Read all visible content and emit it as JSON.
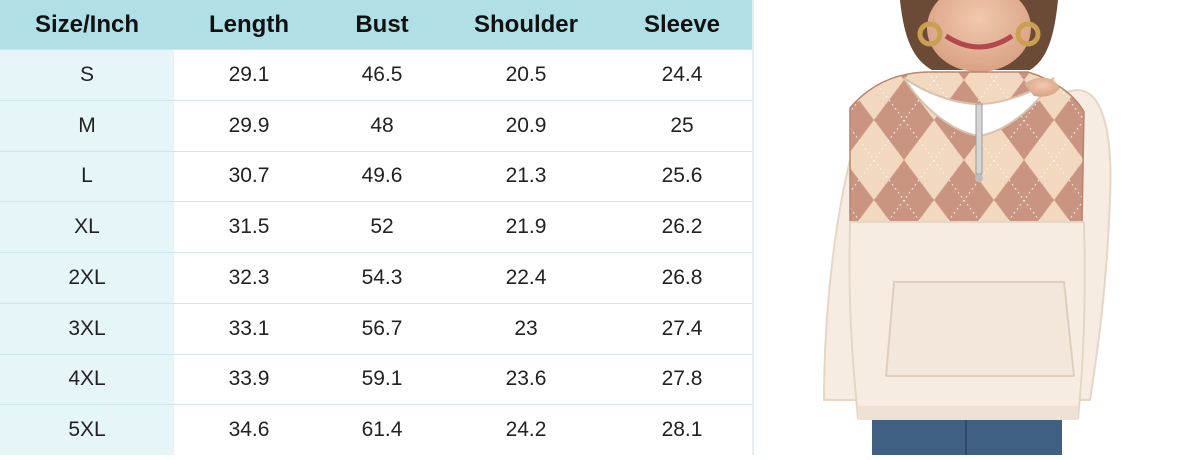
{
  "table": {
    "headers": [
      "Size/Inch",
      "Length",
      "Bust",
      "Shoulder",
      "Sleeve"
    ],
    "rows": [
      [
        "S",
        "29.1",
        "46.5",
        "20.5",
        "24.4"
      ],
      [
        "M",
        "29.9",
        "48",
        "20.9",
        "25"
      ],
      [
        "L",
        "30.7",
        "49.6",
        "21.3",
        "25.6"
      ],
      [
        "XL",
        "31.5",
        "52",
        "21.9",
        "26.2"
      ],
      [
        "2XL",
        "32.3",
        "54.3",
        "22.4",
        "26.8"
      ],
      [
        "3XL",
        "33.1",
        "56.7",
        "23",
        "27.4"
      ],
      [
        "4XL",
        "33.9",
        "59.1",
        "23.6",
        "27.8"
      ],
      [
        "5XL",
        "34.6",
        "61.4",
        "24.2",
        "28.1"
      ]
    ]
  },
  "colors": {
    "header_bg": "#b0dfe5",
    "size_column_bg": "#e6f5f7",
    "argyle_dark": "#c99580",
    "argyle_light": "#f2d8bf",
    "sherpa": "#f6ece2"
  },
  "image": {
    "name": "product-photo-argyle-sherpa-pullover"
  }
}
